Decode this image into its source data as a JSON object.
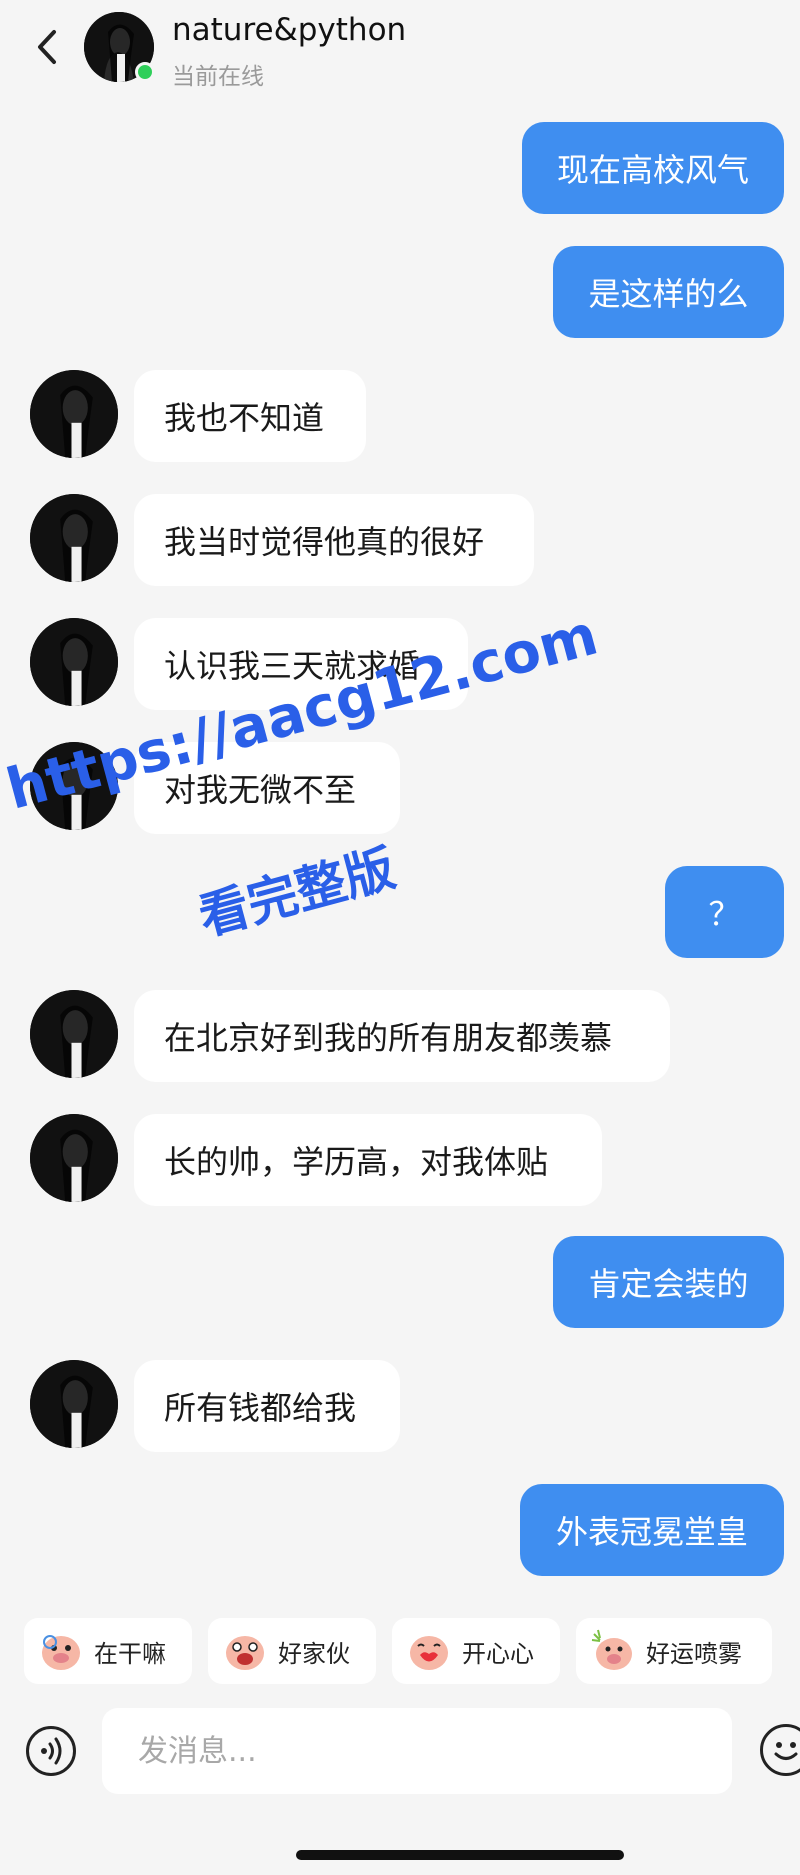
{
  "header": {
    "contact_name": "nature&python",
    "status": "当前在线"
  },
  "messages": [
    {
      "from": "me",
      "text": "现在高校风气"
    },
    {
      "from": "them",
      "text": "是这样的么",
      "note": ""
    },
    {
      "from": "them",
      "text": "我也不知道"
    },
    {
      "from": "them",
      "text": "我当时觉得他真的很好"
    },
    {
      "from": "them",
      "text": "认识我三天就求婚"
    },
    {
      "from": "them",
      "text": "对我无微不至"
    },
    {
      "from": "me",
      "text": "？"
    },
    {
      "from": "them",
      "text": "在北京好到我的所有朋友都羡慕"
    },
    {
      "from": "them",
      "text": "长的帅，学历高，对我体贴"
    },
    {
      "from": "me",
      "text": "肯定会装的"
    },
    {
      "from": "them",
      "text": "所有钱都给我"
    },
    {
      "from": "me",
      "text": "外表冠冕堂皇"
    }
  ],
  "watermark": {
    "line1": "https://aacg12.com",
    "line2": "看完整版"
  },
  "quick_replies": [
    {
      "label": "在干嘛",
      "icon": "pig-emoji-icon"
    },
    {
      "label": "好家伙",
      "icon": "pig-emoji-icon"
    },
    {
      "label": "开心心",
      "icon": "pig-emoji-icon"
    },
    {
      "label": "好运喷雾",
      "icon": "pig-emoji-icon"
    }
  ],
  "composer": {
    "placeholder": "发消息..."
  },
  "colors": {
    "sent_bubble": "#3f8ef0",
    "recv_bubble": "#ffffff",
    "online": "#2fcf5a",
    "watermark": "#2a5fe8"
  }
}
